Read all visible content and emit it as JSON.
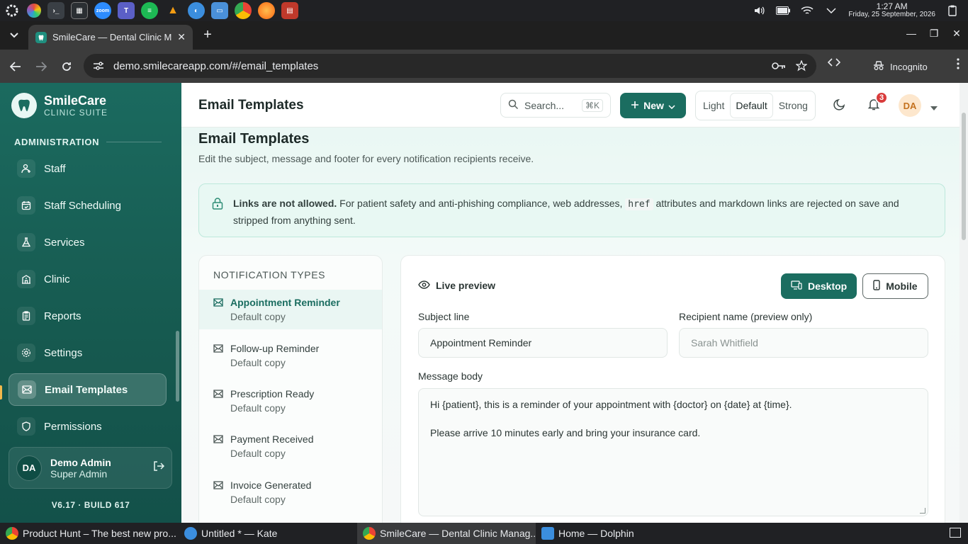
{
  "os": {
    "clock_time": "1:27 AM",
    "clock_date": "Friday, 25 September, 2026",
    "launcher_icons": [
      "app-menu-icon",
      "pinwheel-icon",
      "terminal-icon",
      "calculator-icon",
      "zoom-icon",
      "teams-icon",
      "chat-icon",
      "vlc-icon",
      "browser-icon",
      "files-icon",
      "chrome-icon",
      "firefox-icon",
      "pdf-icon"
    ],
    "zoom_label": "zoom"
  },
  "browser": {
    "tab_title": "SmileCare — Dental Clinic M",
    "url": "demo.smilecareapp.com/#/email_templates",
    "incognito_label": "Incognito"
  },
  "sidebar": {
    "brand_name": "SmileCare",
    "brand_sub": "CLINIC SUITE",
    "section_label": "ADMINISTRATION",
    "items": [
      {
        "label": "Staff",
        "icon": "staff-icon"
      },
      {
        "label": "Staff Scheduling",
        "icon": "calendar-icon"
      },
      {
        "label": "Services",
        "icon": "flask-icon"
      },
      {
        "label": "Clinic",
        "icon": "building-icon"
      },
      {
        "label": "Reports",
        "icon": "clipboard-icon"
      },
      {
        "label": "Settings",
        "icon": "gear-icon"
      },
      {
        "label": "Email Templates",
        "icon": "mail-icon",
        "active": true
      },
      {
        "label": "Permissions",
        "icon": "shield-icon"
      }
    ],
    "user": {
      "initials": "DA",
      "name": "Demo Admin",
      "role": "Super Admin"
    },
    "build": "V6.17 · BUILD 617"
  },
  "topbar": {
    "title": "Email Templates",
    "search_placeholder": "Search...",
    "search_shortcut": "⌘K",
    "new_label": "New",
    "density": [
      "Light",
      "Default",
      "Strong"
    ],
    "density_selected": "Default",
    "notification_count": "3",
    "avatar_initials": "DA"
  },
  "page": {
    "heading": "Email Templates",
    "description": "Edit the subject, message and footer for every notification recipients receive.",
    "alert_bold": "Links are not allowed.",
    "alert_text_1": " For patient safety and anti-phishing compliance, web addresses, ",
    "alert_code": "href",
    "alert_text_2": " attributes and markdown links are rejected on save and stripped from anything sent."
  },
  "notification_types": {
    "header": "NOTIFICATION TYPES",
    "items": [
      {
        "name": "Appointment Reminder",
        "sub": "Default copy",
        "selected": true
      },
      {
        "name": "Follow-up Reminder",
        "sub": "Default copy"
      },
      {
        "name": "Prescription Ready",
        "sub": "Default copy"
      },
      {
        "name": "Payment Received",
        "sub": "Default copy"
      },
      {
        "name": "Invoice Generated",
        "sub": "Default copy"
      }
    ]
  },
  "editor": {
    "preview_label": "Live preview",
    "desktop_label": "Desktop",
    "mobile_label": "Mobile",
    "subject_label": "Subject line",
    "subject_value": "Appointment Reminder",
    "recipient_label": "Recipient name (preview only)",
    "recipient_placeholder": "Sarah Whitfield",
    "body_label": "Message body",
    "body_line_1": "Hi {patient}, this is a reminder of your appointment with {doctor} on {date} at {time}.",
    "body_line_2": "Please arrive 10 minutes early and bring your insurance card."
  },
  "taskbar": {
    "tasks": [
      {
        "label": "Product Hunt – The best new pro...",
        "color": "#e0a020"
      },
      {
        "label": "Untitled * — Kate",
        "color": "#3b8ede"
      },
      {
        "label": "SmileCare — Dental Clinic Manag...",
        "color": "#e0a020",
        "active": true
      },
      {
        "label": "Home — Dolphin",
        "color": "#3b8ede"
      }
    ]
  },
  "colors": {
    "brand": "#1b6d60",
    "sidebar": "#16594f",
    "badge": "#d93b3b",
    "alert_bg": "#e8f8f3"
  }
}
